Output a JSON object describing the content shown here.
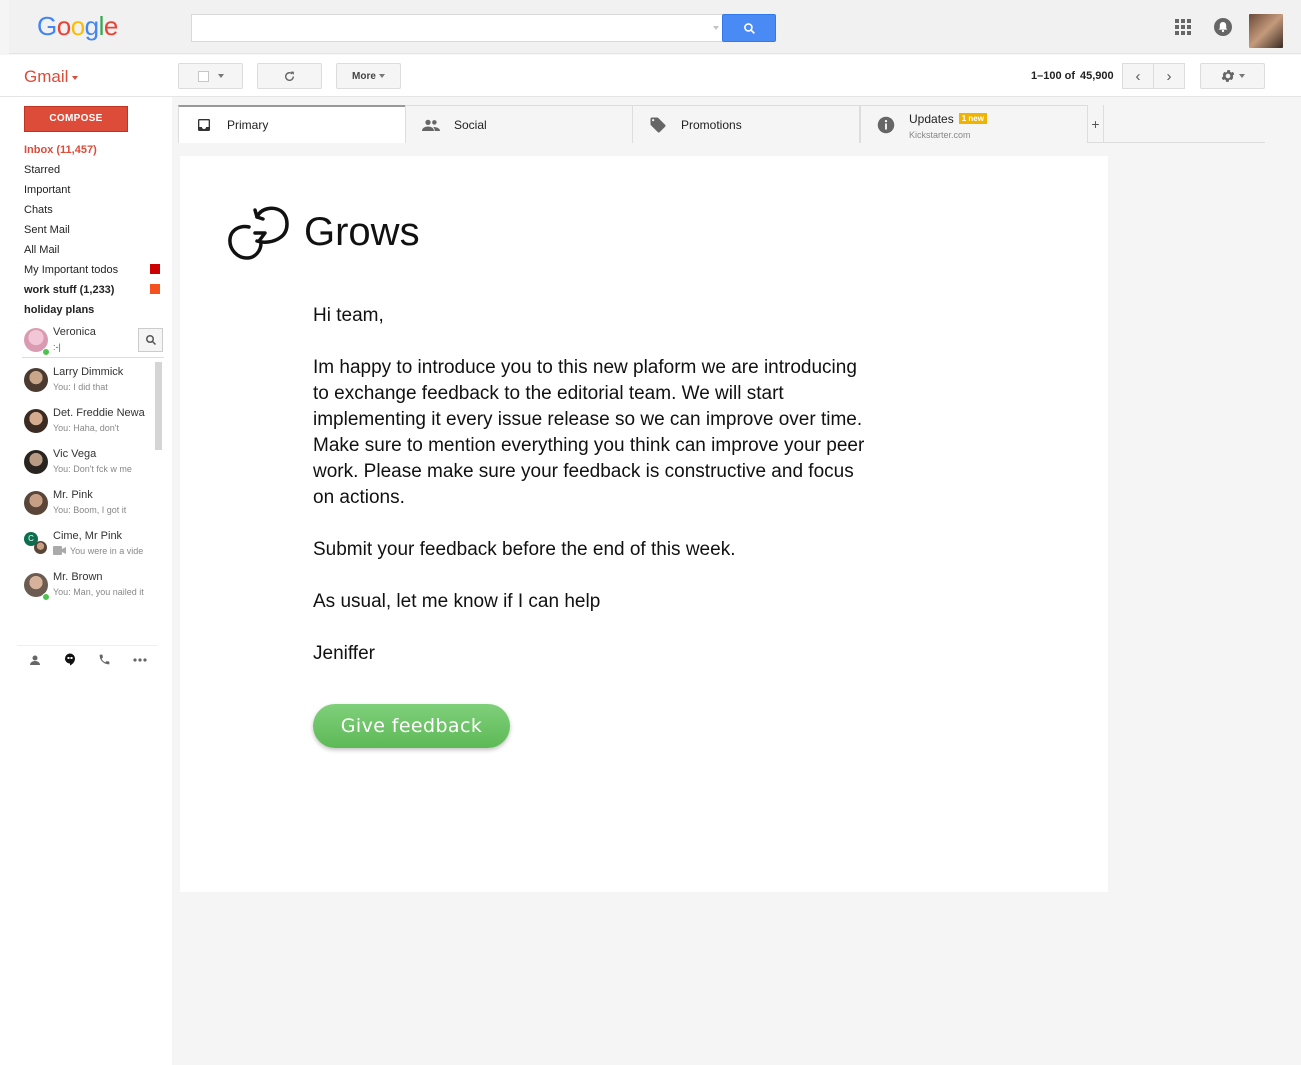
{
  "header": {
    "logo_letters": [
      "G",
      "o",
      "o",
      "g",
      "l",
      "e"
    ],
    "logo_colors": [
      "#4285f4",
      "#ea4335",
      "#fbbc05",
      "#4285f4",
      "#34a853",
      "#ea4335"
    ],
    "search_placeholder": ""
  },
  "toolbar": {
    "app_label": "Gmail",
    "more_label": "More",
    "page_range": "1–100 of",
    "page_total": "45,900"
  },
  "sidebar": {
    "compose_label": "COMPOSE",
    "items": [
      {
        "label": "Inbox (11,457)"
      },
      {
        "label": "Starred"
      },
      {
        "label": "Important"
      },
      {
        "label": "Chats"
      },
      {
        "label": "Sent Mail"
      },
      {
        "label": "All Mail"
      },
      {
        "label": "My Important todos",
        "color": "#cc0000"
      },
      {
        "label": "work stuff (1,233)",
        "color": "#f4511e"
      },
      {
        "label": "holiday plans"
      }
    ]
  },
  "chat": {
    "self": {
      "name": "Veronica",
      "status": ":-|"
    },
    "contacts": [
      {
        "name": "Larry Dimmick",
        "msg": "You: I did that"
      },
      {
        "name": "Det. Freddie Newa",
        "msg": "You: Haha, don't"
      },
      {
        "name": "Vic Vega",
        "msg": "You: Don't fck w me"
      },
      {
        "name": "Mr. Pink",
        "msg": "You: Boom, I got it"
      },
      {
        "name": "Cime, Mr Pink",
        "msg": "You were in a vide"
      },
      {
        "name": "Mr. Brown",
        "msg": "You: Man, you nailed it"
      }
    ]
  },
  "tabs": [
    {
      "label": "Primary",
      "icon": "inbox-icon"
    },
    {
      "label": "Social",
      "icon": "people-icon"
    },
    {
      "label": "Promotions",
      "icon": "tag-icon"
    },
    {
      "label": "Updates",
      "icon": "info-icon",
      "badge": "1 new",
      "sub": "Kickstarter.com"
    }
  ],
  "email": {
    "brand": "Grows",
    "greeting": "Hi team,",
    "paragraph1": "Im happy to introduce you to this new plaform we are introducing to exchange feedback to the editorial team. We will start implementing it every issue release so we can improve over time. Make sure to mention everything you think can improve your peer work. Please make sure your feedback is constructive and focus on actions.",
    "paragraph2": "Submit your feedback before the end of this week.",
    "paragraph3": "As usual, let me know if I can help",
    "signature": "Jeniffer",
    "cta_label": "Give feedback"
  }
}
